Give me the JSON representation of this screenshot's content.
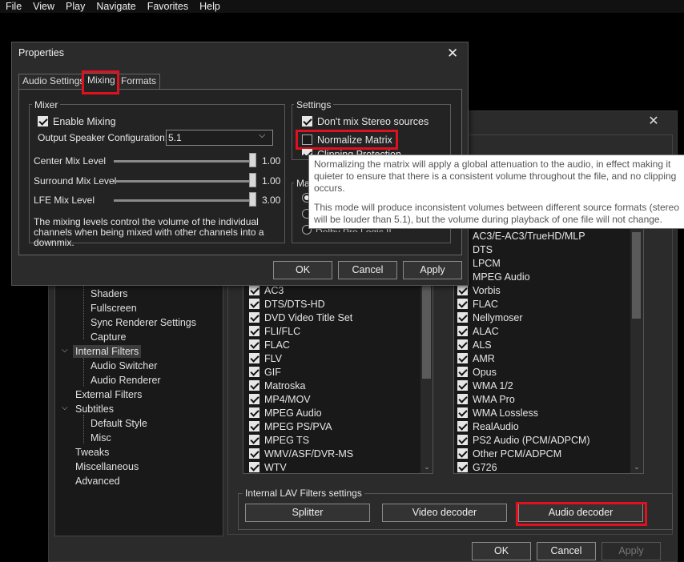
{
  "menubar": {
    "items": [
      "File",
      "View",
      "Play",
      "Navigate",
      "Favorites",
      "Help"
    ]
  },
  "options_dialog": {
    "tree": [
      {
        "label": "Shaders",
        "indent": 2
      },
      {
        "label": "Fullscreen",
        "indent": 2
      },
      {
        "label": "Sync Renderer Settings",
        "indent": 2
      },
      {
        "label": "Capture",
        "indent": 2
      },
      {
        "label": "Internal Filters",
        "indent": 1,
        "expanded": true,
        "selected": true
      },
      {
        "label": "Audio Switcher",
        "indent": 2
      },
      {
        "label": "Audio Renderer",
        "indent": 2
      },
      {
        "label": "External Filters",
        "indent": 1
      },
      {
        "label": "Subtitles",
        "indent": 1,
        "expanded": true
      },
      {
        "label": "Default Style",
        "indent": 2
      },
      {
        "label": "Misc",
        "indent": 2
      },
      {
        "label": "Tweaks",
        "indent": 1
      },
      {
        "label": "Miscellaneous",
        "indent": 1
      },
      {
        "label": "Advanced",
        "indent": 1
      }
    ],
    "source_filters": [
      "AC3",
      "DTS/DTS-HD",
      "DVD Video Title Set",
      "FLI/FLC",
      "FLAC",
      "FLV",
      "GIF",
      "Matroska",
      "MP4/MOV",
      "MPEG Audio",
      "MPEG PS/PVA",
      "MPEG TS",
      "WMV/ASF/DVR-MS",
      "WTV"
    ],
    "audio_decoders": [
      "AC3/E-AC3/TrueHD/MLP",
      "DTS",
      "LPCM",
      "MPEG Audio",
      "Vorbis",
      "FLAC",
      "Nellymoser",
      "ALAC",
      "ALS",
      "AMR",
      "Opus",
      "WMA 1/2",
      "WMA Pro",
      "WMA Lossless",
      "RealAudio",
      "PS2 Audio (PCM/ADPCM)",
      "Other PCM/ADPCM",
      "G726"
    ],
    "lav_group_label": "Internal LAV Filters settings",
    "lav_buttons": {
      "splitter": "Splitter",
      "video": "Video decoder",
      "audio": "Audio decoder"
    },
    "footer": {
      "ok": "OK",
      "cancel": "Cancel",
      "apply": "Apply"
    }
  },
  "properties": {
    "title": "Properties",
    "tabs": [
      "Audio Settings",
      "Mixing",
      "Formats"
    ],
    "active_tab": "Mixing",
    "mixer": {
      "group_label": "Mixer",
      "enable_mixing": "Enable Mixing",
      "output_config_label": "Output Speaker Configuration:",
      "output_config_value": "5.1",
      "levels": [
        {
          "label": "Center Mix Level",
          "value": "1.00"
        },
        {
          "label": "Surround Mix Level",
          "value": "1.00"
        },
        {
          "label": "LFE Mix Level",
          "value": "3.00"
        }
      ],
      "note": "The mixing levels control the volume of the individual channels when being mixed with other channels into a downmix."
    },
    "settings": {
      "group_label": "Settings",
      "dont_mix_stereo": "Don't mix Stereo sources",
      "normalize_matrix": "Normalize Matrix",
      "clipping_partial": "Clipping Protection",
      "matrix_group_partial": "Ma",
      "dolby_partial": "Dolby Pro Logic II"
    },
    "buttons": {
      "ok": "OK",
      "cancel": "Cancel",
      "apply": "Apply"
    }
  },
  "tooltip": {
    "para1": "Normalizing the matrix will apply a global attenuation to the audio, in effect making it quieter to ensure that there is a consistent volume throughout the file, and no clipping occurs.",
    "para2": "This mode will produce inconsistent volumes between different source formats (stereo will be louder than 5.1), but the volume during playback of one file will not change."
  },
  "colors": {
    "highlight_red": "#e0101e",
    "dialog_bg": "#2b2b2b",
    "tooltip_bg": "#ffffff"
  }
}
